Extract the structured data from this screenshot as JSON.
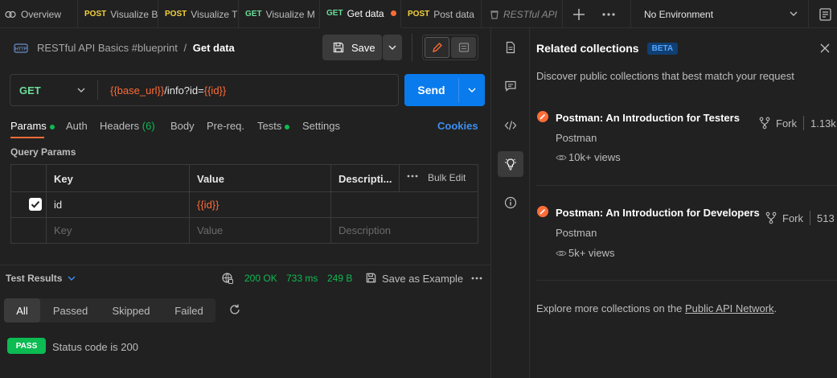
{
  "tabs": [
    {
      "label": "Overview",
      "method": ""
    },
    {
      "label": "Visualize B",
      "method": "POST"
    },
    {
      "label": "Visualize T",
      "method": "POST"
    },
    {
      "label": "Visualize M",
      "method": "GET"
    },
    {
      "label": "Get data",
      "method": "GET"
    },
    {
      "label": "Post data",
      "method": "POST"
    },
    {
      "label": "RESTful API",
      "method": ""
    }
  ],
  "environment": {
    "label": "No Environment"
  },
  "request": {
    "collection": "RESTful API Basics #blueprint",
    "separator": "/",
    "name": "Get data",
    "save_label": "Save",
    "method": "GET",
    "url_var1": "{{base_url}}",
    "url_mid": "/info?id=",
    "url_var2": "{{id}}",
    "send_label": "Send"
  },
  "subtabs": {
    "params": "Params",
    "auth": "Auth",
    "headers": "Headers",
    "headers_count": "(6)",
    "body": "Body",
    "prereq": "Pre-req.",
    "tests": "Tests",
    "settings": "Settings",
    "cookies": "Cookies"
  },
  "query_params": {
    "title": "Query Params",
    "headers": {
      "key": "Key",
      "value": "Value",
      "description": "Descripti...",
      "bulk_edit": "Bulk Edit"
    },
    "row": {
      "key": "id",
      "value": "{{id}}"
    },
    "placeholder": {
      "key": "Key",
      "value": "Value",
      "description": "Description"
    }
  },
  "results": {
    "title": "Test Results",
    "status": "200 OK",
    "time": "733 ms",
    "size": "249 B",
    "save_example": "Save as Example",
    "filters": [
      "All",
      "Passed",
      "Skipped",
      "Failed"
    ],
    "pass_badge": "PASS",
    "test_name": "Status code is 200"
  },
  "related": {
    "title": "Related collections",
    "beta": "BETA",
    "description": "Discover public collections that best match your request",
    "collections": [
      {
        "title": "Postman: An Introduction for Testers",
        "author": "Postman",
        "views": "10k+ views",
        "fork_label": "Fork",
        "fork_count": "1.13k"
      },
      {
        "title": "Postman: An Introduction for Developers",
        "author": "Postman",
        "views": "5k+ views",
        "fork_label": "Fork",
        "fork_count": "513"
      }
    ],
    "explore_prefix": "Explore more collections on the ",
    "explore_link": "Public API Network",
    "explore_suffix": "."
  },
  "colors": {
    "accent": "#ff6c37",
    "send": "#097bed",
    "get": "#6bdd9a",
    "post": "#f4d13d",
    "pass": "#0cbb52"
  }
}
